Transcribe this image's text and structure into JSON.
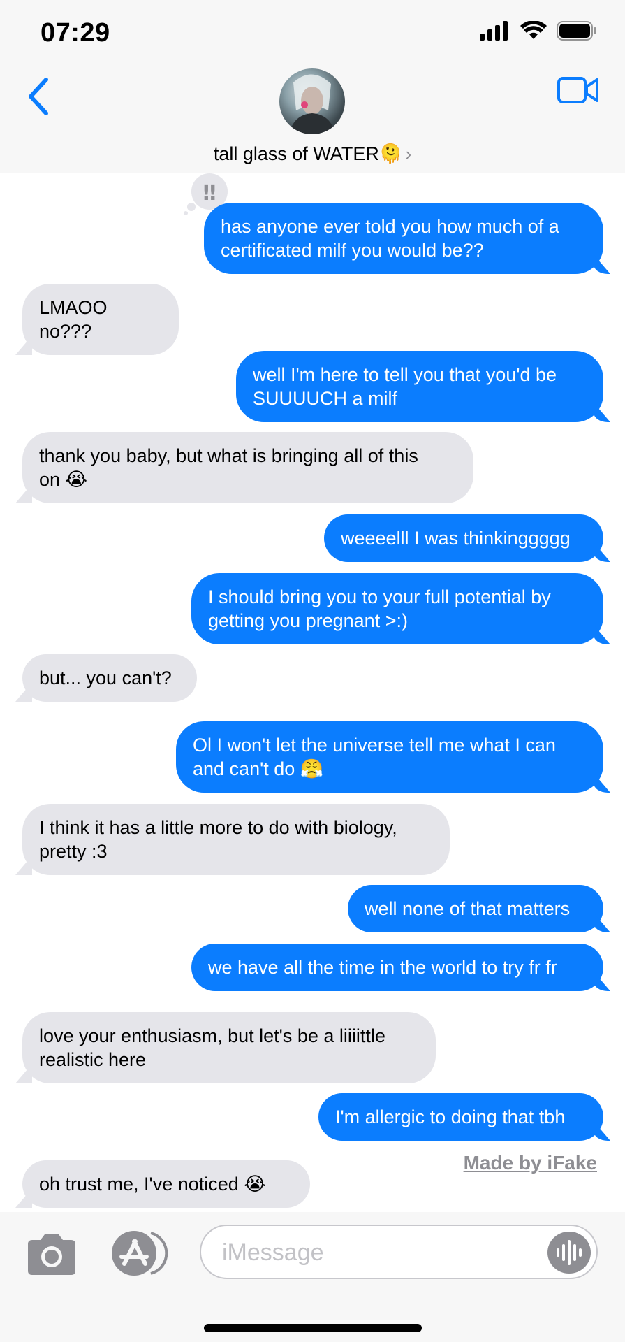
{
  "status_bar": {
    "time": "07:29"
  },
  "header": {
    "contact_name": "tall glass of WATER🫠",
    "chevron": "›"
  },
  "icons": {
    "back": "chevron-left-icon",
    "video": "video-camera-icon",
    "camera": "camera-icon",
    "apps": "app-store-icon",
    "audio": "waveform-icon",
    "tapback": "double-exclamation-icon"
  },
  "colors": {
    "sent": "#0b7dfe",
    "received": "#e5e5ea",
    "accent": "#0b7dfe"
  },
  "messages": [
    {
      "direction": "sent",
      "text": "has anyone ever told you how much of a\ncertificated milf you would be??",
      "tapback": "‼"
    },
    {
      "direction": "received",
      "text": "LMAOO no???"
    },
    {
      "direction": "sent",
      "text": "well I'm here to tell you that you'd be\nSUUUUCH a milf"
    },
    {
      "direction": "received",
      "text": "thank you baby, but what is bringing all of this\non 😭"
    },
    {
      "direction": "sent",
      "text": "weeeelll I was thinkinggggg"
    },
    {
      "direction": "sent",
      "text": "I should bring you to your full potential by\ngetting you pregnant >:)"
    },
    {
      "direction": "received",
      "text": "but... you can't?"
    },
    {
      "direction": "sent",
      "text": "Ol I won't let the universe tell me what I can\nand can't do 😤"
    },
    {
      "direction": "received",
      "text": "I think it has a little more to do with biology,\npretty :3"
    },
    {
      "direction": "sent",
      "text": "well none of that matters"
    },
    {
      "direction": "sent",
      "text": "we have all the time in the world to try fr fr"
    },
    {
      "direction": "received",
      "text": "love your enthusiasm, but let's be a liiiittle\nrealistic here"
    },
    {
      "direction": "sent",
      "text": "I'm allergic to doing that tbh"
    },
    {
      "direction": "received",
      "text": "oh trust me, I've noticed 😭"
    }
  ],
  "watermark": "Made by iFake",
  "input": {
    "placeholder": "iMessage",
    "value": ""
  }
}
